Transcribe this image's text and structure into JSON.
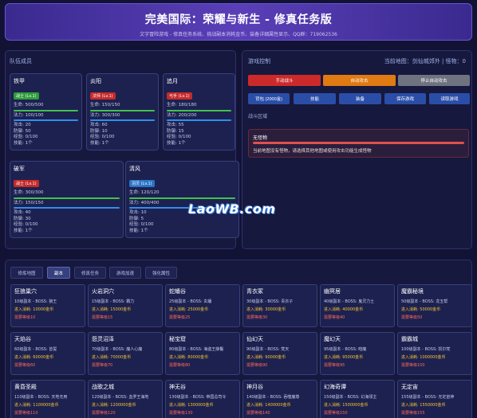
{
  "header": {
    "title": "完美国际：荣耀与新生 - 修真任务版",
    "subtitle": "文字冒险游戏 - 修真任务系统、挑战副本消耗金币、装备详细属性显示、QQ群：719062536"
  },
  "team": {
    "title": "队伍成员",
    "members": [
      {
        "name": "铁甲",
        "badge": "战士 (Lv.1)",
        "badge_color": "#2e9c3a",
        "hp": "生命: 500/500",
        "hp_pct": 1.0,
        "mp": "法力: 100/100",
        "mp_pct": 1.0,
        "atk": "攻击: 20",
        "def": "防御: 50",
        "exp": "经验: 0/100",
        "skill": "技能: 1个"
      },
      {
        "name": "炎阳",
        "badge": "法师 (Lv.1)",
        "badge_color": "#c52a2a",
        "hp": "生命: 150/150",
        "hp_pct": 1.0,
        "mp": "法力: 300/300",
        "mp_pct": 1.0,
        "atk": "攻击: 60",
        "def": "防御: 10",
        "exp": "经验: 0/100",
        "skill": "技能: 1个"
      },
      {
        "name": "追月",
        "badge": "弓手 (Lv.1)",
        "badge_color": "#c52a2a",
        "hp": "生命: 180/180",
        "hp_pct": 1.0,
        "mp": "法力: 200/200",
        "mp_pct": 1.0,
        "atk": "攻击: 55",
        "def": "防御: 15",
        "exp": "经验: 0/100",
        "skill": "技能: 1个"
      },
      {
        "name": "破军",
        "badge": "战士 (Lv.1)",
        "badge_color": "#c52a2a",
        "hp": "生命: 300/300",
        "hp_pct": 1.0,
        "mp": "法力: 150/150",
        "mp_pct": 1.0,
        "atk": "攻击: 40",
        "def": "防御: 30",
        "exp": "经验: 0/100",
        "skill": "技能: 1个"
      },
      {
        "name": "清风",
        "badge": "羽灵 (Lv.1)",
        "badge_color": "#2a74c5",
        "hp": "生命: 120/120",
        "hp_pct": 1.0,
        "mp": "法力: 400/400",
        "mp_pct": 1.0,
        "atk": "攻击: 10",
        "def": "防御: 5",
        "exp": "经验: 0/100",
        "skill": "技能: 1个"
      }
    ]
  },
  "control": {
    "title": "游戏控制",
    "location": "当前地图：剑仙城郊外 | 怪物：0",
    "buttons": {
      "attack": "手动战斗",
      "auto": "自动攻击",
      "stop": "停止自动攻击",
      "bag": "背包 (2000金)",
      "skill": "技能",
      "equip": "装备",
      "save": "保存游戏",
      "load": "读取游戏"
    },
    "battle_label": "战斗区域",
    "monster_name": "无怪物",
    "monster_tip": "当前地图没有怪物，请选择其他地图或使用攻击功能生成怪物",
    "watermark": "LaoWB.com"
  },
  "maps": {
    "tabs": [
      "修炼地图",
      "副本",
      "修真任务",
      "游戏加速",
      "强化属性"
    ],
    "active_tab": 1,
    "cards": [
      {
        "name": "狂狼巢穴",
        "info": "10级副本 - BOSS: 狼王",
        "cost": "进入消耗: 10000金币",
        "level": "需要等级10"
      },
      {
        "name": "火岩洞穴",
        "info": "15级副本 - BOSS: 霸力",
        "cost": "进入消耗: 15000金币",
        "level": "需要等级15"
      },
      {
        "name": "蛇蟠谷",
        "info": "25级副本 - BOSS: 玄蟠",
        "cost": "进入消耗: 25000金币",
        "level": "需要等级25"
      },
      {
        "name": "青衣冢",
        "info": "30级副本 - BOSS: 青衣子",
        "cost": "进入消耗: 30000金币",
        "level": "需要等级30"
      },
      {
        "name": "幽冥居",
        "info": "40级副本 - BOSS: 鬼灵力士",
        "cost": "进入消耗: 40000金币",
        "level": "需要等级40"
      },
      {
        "name": "魔霸秘境",
        "info": "50级副本 - BOSS: 龙五帮",
        "cost": "进入消耗: 50000金币",
        "level": "需要等级50"
      },
      {
        "name": "天焰谷",
        "info": "60级副本 - BOSS: 皆誓",
        "cost": "进入消耗: 60000金币",
        "level": "需要等级60"
      },
      {
        "name": "怨灵沼泽",
        "info": "70级副本 - BOSS: 魔人心魔",
        "cost": "进入消耗: 70000金币",
        "level": "需要等级70"
      },
      {
        "name": "秘宝窟",
        "info": "80级副本 - BOSS: 海盗王薛鬣",
        "cost": "进入消耗: 80000金币",
        "level": "需要等级80"
      },
      {
        "name": "仙幻天",
        "info": "90级副本 - BOSS: 梵天",
        "cost": "进入消耗: 90000金币",
        "level": "需要等级90"
      },
      {
        "name": "魔幻天",
        "info": "95级副本 - BOSS: 暗魔",
        "cost": "进入消耗: 95000金币",
        "level": "需要等级95"
      },
      {
        "name": "霸霸城",
        "info": "100级副本 - BOSS: 凯尔梵",
        "cost": "进入消耗: 1000000金币",
        "level": "需要等级100"
      },
      {
        "name": "黄昏圣殿",
        "info": "110级副本 - BOSS: 天地无用",
        "cost": "进入消耗: 1100000金币",
        "level": "需要等级110"
      },
      {
        "name": "战歌之城",
        "info": "120级副本 - BOSS: 血罗王海地",
        "cost": "进入消耗: 1200000金币",
        "level": "需要等级120"
      },
      {
        "name": "神无谷",
        "info": "130级副本 - BOSS: 帝国总司令",
        "cost": "进入消耗: 1300000金币",
        "level": "需要等级130"
      },
      {
        "name": "神月谷",
        "info": "140级副本 - BOSS: 吞噬魔尊",
        "cost": "进入消耗: 1400000金币",
        "level": "需要等级140"
      },
      {
        "name": "幻海奇谭",
        "info": "150级副本 - BOSS: 幻海领主",
        "cost": "进入消耗: 1500000金币",
        "level": "需要等级150"
      },
      {
        "name": "无定宙",
        "info": "155级副本 - BOSS: 无定宙神",
        "cost": "进入消耗: 1550000金币",
        "level": "需要等级155"
      }
    ]
  }
}
